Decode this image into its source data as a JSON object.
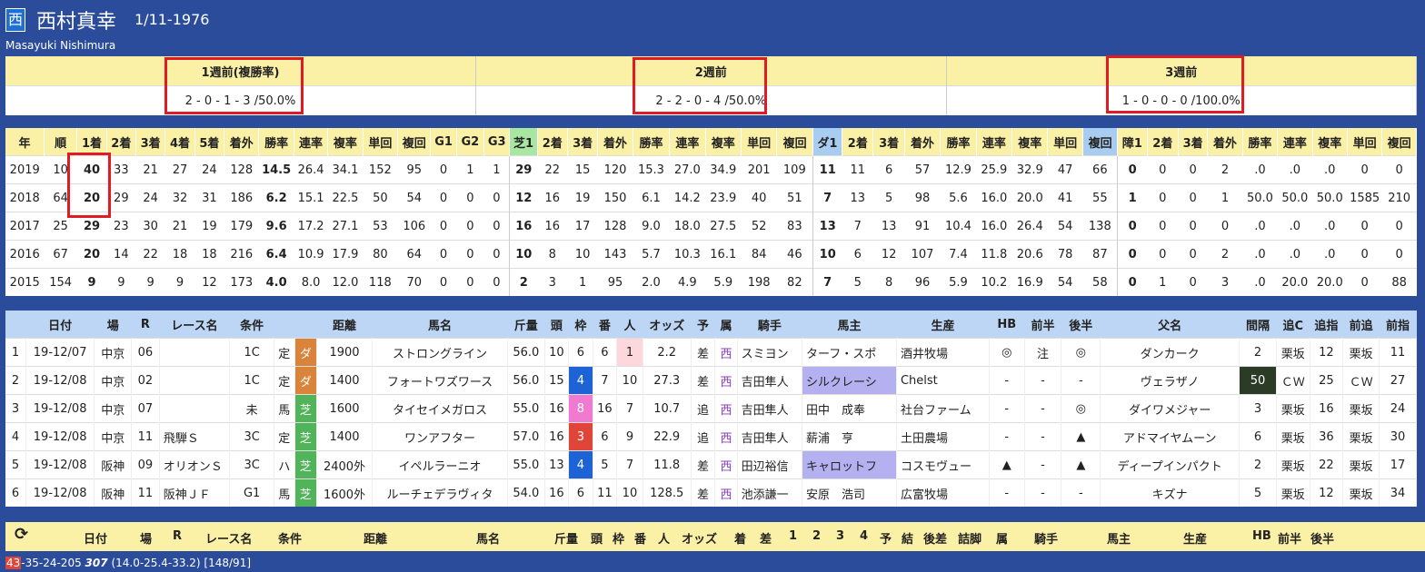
{
  "header": {
    "badge": "西",
    "jockey_name": "西村真幸",
    "dob": "1/11-1976",
    "romaji": "Masayuki Nishimura"
  },
  "weeks": [
    {
      "label": "1週前(複勝率)",
      "value": "2 - 0 - 1 - 3 /50.0%"
    },
    {
      "label": "2週前",
      "value": "2 - 2 - 0 - 4 /50.0%"
    },
    {
      "label": "3週前",
      "value": "1 - 0 - 0 - 0 /100.0%"
    }
  ],
  "stats": {
    "headers": [
      "年",
      "順",
      "1着",
      "2着",
      "3着",
      "4着",
      "5着",
      "着外",
      "勝率",
      "連率",
      "複率",
      "単回",
      "複回",
      "G1",
      "G2",
      "G3",
      "芝1",
      "2着",
      "3着",
      "着外",
      "勝率",
      "連率",
      "複率",
      "単回",
      "複回",
      "ダ1",
      "2着",
      "3着",
      "着外",
      "勝率",
      "連率",
      "複率",
      "単回",
      "複回",
      "障1",
      "2着",
      "3着",
      "着外",
      "勝率",
      "連率",
      "複率",
      "単回",
      "複回"
    ],
    "rows": [
      [
        "2019",
        "10",
        "40",
        "33",
        "21",
        "27",
        "24",
        "128",
        "14.5",
        "26.4",
        "34.1",
        "152",
        "95",
        "0",
        "1",
        "1",
        "29",
        "22",
        "15",
        "120",
        "15.3",
        "27.0",
        "34.9",
        "201",
        "109",
        "11",
        "11",
        "6",
        "57",
        "12.9",
        "25.9",
        "32.9",
        "47",
        "66",
        "0",
        "0",
        "0",
        "2",
        ".0",
        ".0",
        ".0",
        "0",
        "0"
      ],
      [
        "2018",
        "64",
        "20",
        "29",
        "24",
        "32",
        "31",
        "186",
        "6.2",
        "15.1",
        "22.5",
        "50",
        "54",
        "0",
        "0",
        "0",
        "12",
        "16",
        "19",
        "150",
        "6.1",
        "14.2",
        "23.9",
        "40",
        "51",
        "7",
        "13",
        "5",
        "98",
        "5.6",
        "16.0",
        "20.0",
        "41",
        "55",
        "1",
        "0",
        "0",
        "1",
        "50.0",
        "50.0",
        "50.0",
        "1585",
        "210"
      ],
      [
        "2017",
        "25",
        "29",
        "23",
        "30",
        "21",
        "19",
        "179",
        "9.6",
        "17.2",
        "27.1",
        "53",
        "106",
        "0",
        "0",
        "0",
        "16",
        "16",
        "17",
        "128",
        "9.0",
        "18.0",
        "27.5",
        "52",
        "83",
        "13",
        "7",
        "13",
        "91",
        "10.4",
        "16.0",
        "26.4",
        "54",
        "138",
        "0",
        "0",
        "0",
        "0",
        ".0",
        ".0",
        ".0",
        "0",
        "0"
      ],
      [
        "2016",
        "67",
        "20",
        "14",
        "22",
        "18",
        "18",
        "216",
        "6.4",
        "10.9",
        "17.9",
        "80",
        "64",
        "0",
        "0",
        "0",
        "10",
        "8",
        "10",
        "143",
        "5.7",
        "10.3",
        "16.1",
        "84",
        "46",
        "10",
        "6",
        "12",
        "107",
        "7.4",
        "11.8",
        "20.6",
        "78",
        "87",
        "0",
        "0",
        "0",
        "2",
        ".0",
        ".0",
        ".0",
        "0",
        "0"
      ],
      [
        "2015",
        "154",
        "9",
        "9",
        "9",
        "9",
        "12",
        "173",
        "4.0",
        "8.0",
        "12.0",
        "118",
        "70",
        "0",
        "0",
        "0",
        "2",
        "3",
        "1",
        "95",
        "2.0",
        "4.9",
        "5.9",
        "198",
        "82",
        "7",
        "5",
        "8",
        "96",
        "5.9",
        "10.2",
        "16.9",
        "54",
        "58",
        "0",
        "1",
        "0",
        "3",
        ".0",
        "20.0",
        "20.0",
        "0",
        "88"
      ]
    ]
  },
  "races": {
    "headers": [
      "",
      "日付",
      "場",
      "R",
      "レース名",
      "条件",
      "",
      "",
      "距離",
      "馬名",
      "斤量",
      "頭",
      "枠",
      "番",
      "人",
      "オッズ",
      "予",
      "属",
      "騎手",
      "馬主",
      "生産",
      "HB",
      "前半",
      "後半",
      "父名",
      "間隔",
      "追C",
      "追指",
      "前追",
      "前指"
    ],
    "rows": [
      [
        "1",
        "19-12/07",
        "中京",
        "06",
        "",
        "1C",
        "定",
        "ダ",
        "1900",
        "ストロングライン",
        "56.0",
        "10",
        "6",
        "6",
        "1",
        "2.2",
        "差",
        "西",
        "スミヨン",
        "ターフ・スポ",
        "酒井牧場",
        "◎",
        "注",
        "◎",
        "ダンカーク",
        "2",
        "栗坂",
        "12",
        "栗坂",
        "11"
      ],
      [
        "2",
        "19-12/08",
        "中京",
        "02",
        "",
        "1C",
        "定",
        "ダ",
        "1400",
        "フォートワズワース",
        "56.0",
        "15",
        "4",
        "7",
        "10",
        "27.3",
        "差",
        "西",
        "吉田隼人",
        "シルクレーシ",
        "Chelst",
        "-",
        "-",
        "-",
        "ヴェラザノ",
        "50",
        "ＣＷ",
        "25",
        "ＣＷ",
        "27"
      ],
      [
        "3",
        "19-12/08",
        "中京",
        "07",
        "",
        "未",
        "馬",
        "芝",
        "1600",
        "タイセイメガロス",
        "55.0",
        "16",
        "8",
        "16",
        "7",
        "10.7",
        "追",
        "西",
        "吉田隼人",
        "田中　成奉",
        "社台ファーム",
        "-",
        "-",
        "◎",
        "ダイワメジャー",
        "3",
        "栗坂",
        "16",
        "栗坂",
        "24"
      ],
      [
        "4",
        "19-12/08",
        "中京",
        "11",
        "飛騨Ｓ",
        "3C",
        "定",
        "芝",
        "1400",
        "ワンアフター",
        "57.0",
        "16",
        "3",
        "6",
        "9",
        "22.9",
        "追",
        "西",
        "吉田隼人",
        "薪浦　亨",
        "土田農場",
        "-",
        "-",
        "▲",
        "アドマイヤムーン",
        "6",
        "栗坂",
        "36",
        "栗坂",
        "30"
      ],
      [
        "5",
        "19-12/08",
        "阪神",
        "09",
        "オリオンＳ",
        "3C",
        "ハ",
        "芝",
        "2400外",
        "イペルラーニオ",
        "55.0",
        "13",
        "4",
        "5",
        "7",
        "11.8",
        "差",
        "西",
        "田辺裕信",
        "キャロットフ",
        "コスモヴュー",
        "▲",
        "-",
        "▲",
        "ディープインパクト",
        "2",
        "栗坂",
        "22",
        "栗坂",
        "17"
      ],
      [
        "6",
        "19-12/08",
        "阪神",
        "11",
        "阪神ＪＦ",
        "G1",
        "馬",
        "芝",
        "1600外",
        "ルーチェデラヴィタ",
        "54.0",
        "16",
        "6",
        "11",
        "10",
        "128.5",
        "差",
        "西",
        "池添謙一",
        "安原　浩司",
        "広富牧場",
        "-",
        "-",
        "-",
        "キズナ",
        "5",
        "栗坂",
        "12",
        "栗坂",
        "34"
      ]
    ]
  },
  "bottom_bar": {
    "labels": [
      "日付",
      "場",
      "R",
      "レース名",
      "条件",
      "距離",
      "馬名",
      "斤量",
      "頭",
      "枠",
      "番",
      "人",
      "オッズ",
      "着",
      "差",
      "1",
      "2",
      "3",
      "4",
      "予",
      "結",
      "後差",
      "詰脚",
      "属",
      "騎手",
      "馬主",
      "生産",
      "HB",
      "前半",
      "後半"
    ]
  },
  "footer": {
    "badge": "43",
    "text": "-35-24-205",
    "bold": "307",
    "rest": "(14.0-25.4-33.2) [148/91]"
  }
}
